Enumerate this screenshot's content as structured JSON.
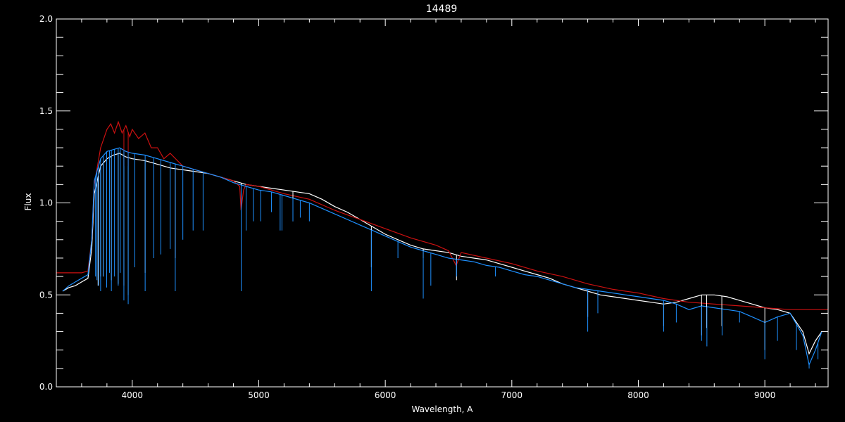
{
  "chart_data": {
    "type": "line",
    "title": "14489",
    "xlabel": "Wavelength, A",
    "ylabel": "Flux",
    "xlim": [
      3400,
      9500
    ],
    "ylim": [
      0.0,
      2.0
    ],
    "xticks": [
      4000,
      5000,
      6000,
      7000,
      8000,
      9000
    ],
    "xtick_labels": [
      "4000",
      "5000",
      "6000",
      "7000",
      "8000",
      "9000"
    ],
    "xminor_step": 200,
    "yticks": [
      0.0,
      0.5,
      1.0,
      1.5,
      2.0
    ],
    "ytick_labels": [
      "0.0",
      "0.5",
      "1.0",
      "1.5",
      "2.0"
    ],
    "yminor_step": 0.1,
    "grid": false,
    "background": "#000000",
    "axis_color": "#ffffff",
    "series": [
      {
        "color": "#ffffff",
        "x": [
          3450,
          3500,
          3550,
          3600,
          3650,
          3680,
          3700,
          3750,
          3800,
          3850,
          3900,
          3950,
          4000,
          4100,
          4200,
          4300,
          4400,
          4500,
          4600,
          4700,
          4800,
          4900,
          5000,
          5100,
          5200,
          5300,
          5400,
          5500,
          5600,
          5700,
          5800,
          5900,
          6000,
          6100,
          6200,
          6300,
          6400,
          6500,
          6600,
          6700,
          6800,
          6900,
          7000,
          7100,
          7200,
          7300,
          7400,
          7500,
          7600,
          7700,
          7800,
          7900,
          8000,
          8100,
          8200,
          8300,
          8400,
          8500,
          8600,
          8700,
          8800,
          8900,
          9000,
          9100,
          9200,
          9300,
          9350,
          9400,
          9450
        ],
        "y": [
          0.52,
          0.54,
          0.55,
          0.57,
          0.59,
          0.75,
          1.05,
          1.2,
          1.24,
          1.26,
          1.27,
          1.25,
          1.24,
          1.23,
          1.21,
          1.19,
          1.18,
          1.17,
          1.16,
          1.14,
          1.12,
          1.1,
          1.09,
          1.08,
          1.07,
          1.06,
          1.05,
          1.02,
          0.98,
          0.95,
          0.91,
          0.87,
          0.83,
          0.8,
          0.77,
          0.75,
          0.74,
          0.73,
          0.71,
          0.7,
          0.69,
          0.67,
          0.65,
          0.63,
          0.61,
          0.59,
          0.56,
          0.54,
          0.52,
          0.5,
          0.49,
          0.48,
          0.47,
          0.46,
          0.45,
          0.46,
          0.48,
          0.5,
          0.5,
          0.49,
          0.47,
          0.45,
          0.43,
          0.42,
          0.4,
          0.3,
          0.18,
          0.25,
          0.3
        ]
      },
      {
        "color": "#cc1111",
        "x": [
          3400,
          3500,
          3600,
          3650,
          3680,
          3700,
          3750,
          3800,
          3830,
          3860,
          3890,
          3920,
          3950,
          3980,
          4000,
          4050,
          4100,
          4150,
          4200,
          4250,
          4300,
          4400,
          4500,
          4600,
          4700,
          4800,
          4850,
          4860,
          4880,
          4900,
          5000,
          5200,
          5400,
          5600,
          5800,
          6000,
          6200,
          6400,
          6500,
          6560,
          6600,
          6800,
          7000,
          7200,
          7400,
          7600,
          7800,
          8000,
          8200,
          8400,
          8600,
          8800,
          9000,
          9200,
          9400,
          9500
        ],
        "y": [
          0.62,
          0.62,
          0.62,
          0.63,
          0.8,
          1.1,
          1.3,
          1.4,
          1.43,
          1.38,
          1.44,
          1.38,
          1.42,
          1.36,
          1.4,
          1.35,
          1.38,
          1.3,
          1.3,
          1.24,
          1.27,
          1.2,
          1.18,
          1.16,
          1.14,
          1.12,
          1.09,
          0.96,
          1.07,
          1.1,
          1.09,
          1.05,
          1.02,
          0.96,
          0.91,
          0.86,
          0.81,
          0.77,
          0.74,
          0.66,
          0.73,
          0.7,
          0.67,
          0.63,
          0.6,
          0.56,
          0.53,
          0.51,
          0.48,
          0.46,
          0.45,
          0.44,
          0.43,
          0.42,
          0.42,
          0.42
        ]
      },
      {
        "color": "#1e90ff",
        "x": [
          3450,
          3500,
          3550,
          3600,
          3650,
          3680,
          3700,
          3750,
          3800,
          3850,
          3900,
          3950,
          4000,
          4100,
          4200,
          4300,
          4400,
          4500,
          4600,
          4700,
          4800,
          4900,
          5000,
          5100,
          5200,
          5300,
          5400,
          5500,
          5600,
          5700,
          5800,
          5900,
          6000,
          6100,
          6200,
          6300,
          6400,
          6500,
          6600,
          6700,
          6800,
          6900,
          7000,
          7100,
          7200,
          7300,
          7400,
          7500,
          7600,
          7700,
          7800,
          7900,
          8000,
          8100,
          8200,
          8300,
          8400,
          8500,
          8600,
          8700,
          8800,
          8900,
          9000,
          9100,
          9200,
          9300,
          9350,
          9400,
          9450
        ],
        "y": [
          0.52,
          0.55,
          0.57,
          0.59,
          0.61,
          0.8,
          1.12,
          1.24,
          1.28,
          1.29,
          1.3,
          1.28,
          1.27,
          1.26,
          1.24,
          1.22,
          1.2,
          1.18,
          1.16,
          1.14,
          1.11,
          1.09,
          1.07,
          1.06,
          1.04,
          1.02,
          1.0,
          0.97,
          0.94,
          0.91,
          0.88,
          0.85,
          0.82,
          0.79,
          0.76,
          0.74,
          0.72,
          0.7,
          0.69,
          0.68,
          0.66,
          0.65,
          0.63,
          0.61,
          0.6,
          0.58,
          0.56,
          0.54,
          0.53,
          0.52,
          0.51,
          0.5,
          0.49,
          0.48,
          0.47,
          0.45,
          0.42,
          0.44,
          0.43,
          0.42,
          0.41,
          0.38,
          0.35,
          0.38,
          0.4,
          0.28,
          0.12,
          0.2,
          0.3
        ]
      }
    ],
    "absorption_lines": {
      "white": [
        {
          "x": 3730,
          "y": 0.55
        },
        {
          "x": 3750,
          "y": 0.6
        },
        {
          "x": 3770,
          "y": 0.6
        },
        {
          "x": 3798,
          "y": 0.57
        },
        {
          "x": 3835,
          "y": 0.58
        },
        {
          "x": 3889,
          "y": 0.56
        },
        {
          "x": 3934,
          "y": 0.55
        },
        {
          "x": 3968,
          "y": 0.5
        },
        {
          "x": 4102,
          "y": 0.62
        },
        {
          "x": 4340,
          "y": 0.7
        },
        {
          "x": 4861,
          "y": 0.6
        },
        {
          "x": 5270,
          "y": 0.9
        },
        {
          "x": 5890,
          "y": 0.65
        },
        {
          "x": 6300,
          "y": 0.7
        },
        {
          "x": 6563,
          "y": 0.58
        },
        {
          "x": 7600,
          "y": 0.38
        },
        {
          "x": 8200,
          "y": 0.33
        },
        {
          "x": 8500,
          "y": 0.28
        },
        {
          "x": 8540,
          "y": 0.32
        },
        {
          "x": 8660,
          "y": 0.33
        },
        {
          "x": 9000,
          "y": 0.2
        }
      ],
      "blue": [
        {
          "x": 3710,
          "y": 0.6
        },
        {
          "x": 3721,
          "y": 0.58
        },
        {
          "x": 3734,
          "y": 0.55
        },
        {
          "x": 3750,
          "y": 0.52
        },
        {
          "x": 3771,
          "y": 0.6
        },
        {
          "x": 3798,
          "y": 0.54
        },
        {
          "x": 3820,
          "y": 0.62
        },
        {
          "x": 3835,
          "y": 0.52
        },
        {
          "x": 3860,
          "y": 0.6
        },
        {
          "x": 3889,
          "y": 0.55
        },
        {
          "x": 3905,
          "y": 0.62
        },
        {
          "x": 3934,
          "y": 0.47
        },
        {
          "x": 3968,
          "y": 0.45
        },
        {
          "x": 4020,
          "y": 0.65
        },
        {
          "x": 4102,
          "y": 0.52
        },
        {
          "x": 4170,
          "y": 0.7
        },
        {
          "x": 4226,
          "y": 0.72
        },
        {
          "x": 4300,
          "y": 0.75
        },
        {
          "x": 4340,
          "y": 0.52
        },
        {
          "x": 4400,
          "y": 0.8
        },
        {
          "x": 4481,
          "y": 0.85
        },
        {
          "x": 4560,
          "y": 0.85
        },
        {
          "x": 4861,
          "y": 0.52
        },
        {
          "x": 4900,
          "y": 0.85
        },
        {
          "x": 4957,
          "y": 0.9
        },
        {
          "x": 5015,
          "y": 0.9
        },
        {
          "x": 5100,
          "y": 0.95
        },
        {
          "x": 5169,
          "y": 0.85
        },
        {
          "x": 5183,
          "y": 0.85
        },
        {
          "x": 5270,
          "y": 0.9
        },
        {
          "x": 5328,
          "y": 0.92
        },
        {
          "x": 5400,
          "y": 0.9
        },
        {
          "x": 5890,
          "y": 0.52
        },
        {
          "x": 6100,
          "y": 0.7
        },
        {
          "x": 6300,
          "y": 0.48
        },
        {
          "x": 6360,
          "y": 0.55
        },
        {
          "x": 6563,
          "y": 0.6
        },
        {
          "x": 6870,
          "y": 0.6
        },
        {
          "x": 7600,
          "y": 0.3
        },
        {
          "x": 7680,
          "y": 0.4
        },
        {
          "x": 8200,
          "y": 0.3
        },
        {
          "x": 8300,
          "y": 0.35
        },
        {
          "x": 8500,
          "y": 0.25
        },
        {
          "x": 8542,
          "y": 0.22
        },
        {
          "x": 8662,
          "y": 0.28
        },
        {
          "x": 8800,
          "y": 0.35
        },
        {
          "x": 9000,
          "y": 0.15
        },
        {
          "x": 9100,
          "y": 0.25
        },
        {
          "x": 9250,
          "y": 0.2
        },
        {
          "x": 9350,
          "y": 0.1
        },
        {
          "x": 9420,
          "y": 0.15
        }
      ],
      "red": [
        {
          "x": 3934,
          "y": 1.2
        },
        {
          "x": 3968,
          "y": 1.2
        },
        {
          "x": 4861,
          "y": 0.96
        },
        {
          "x": 6563,
          "y": 0.66
        }
      ]
    }
  }
}
